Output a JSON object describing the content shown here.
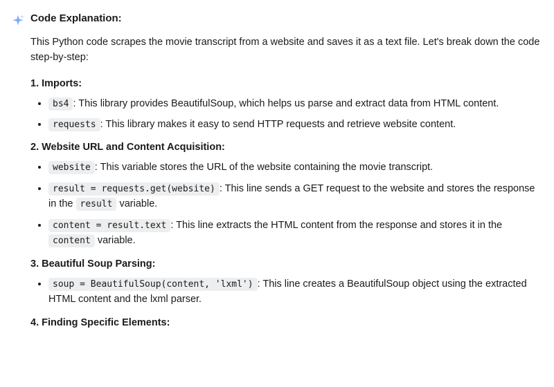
{
  "title": "Code Explanation:",
  "intro": "This Python code scrapes the movie transcript from a website and saves it as a text file. Let's break down the code step-by-step:",
  "sections": [
    {
      "heading": "1. Imports:",
      "items": [
        {
          "code": "bs4",
          "text": ": This library provides BeautifulSoup, which helps us parse and extract data from HTML content."
        },
        {
          "code": "requests",
          "text": ": This library makes it easy to send HTTP requests and retrieve website content."
        }
      ]
    },
    {
      "heading": "2. Website URL and Content Acquisition:",
      "items": [
        {
          "code": "website",
          "text": ": This variable stores the URL of the website containing the movie transcript."
        },
        {
          "code": "result = requests.get(website)",
          "text": ": This line sends a GET request to the website and stores the response in the ",
          "code2": "result",
          "text2": " variable."
        },
        {
          "code": "content = result.text",
          "text": ": This line extracts the HTML content from the response and stores it in the ",
          "code2": "content",
          "text2": " variable."
        }
      ]
    },
    {
      "heading": "3. Beautiful Soup Parsing:",
      "items": [
        {
          "code": "soup = BeautifulSoup(content, 'lxml')",
          "text": ": This line creates a BeautifulSoup object using the extracted HTML content and the lxml parser."
        }
      ]
    },
    {
      "heading": "4. Finding Specific Elements:",
      "items": []
    }
  ]
}
